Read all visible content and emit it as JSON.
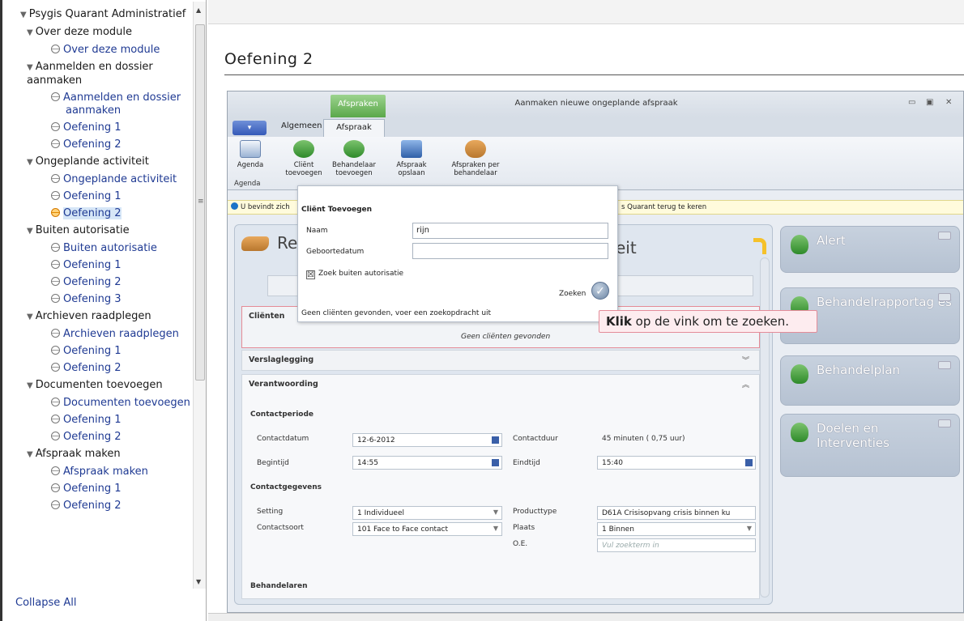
{
  "sidebar": {
    "items": [
      {
        "level": 0,
        "arrow": "▼",
        "label": "Psygis Quarant Administratief"
      },
      {
        "level": 1,
        "arrow": "▼",
        "label": "Over deze module"
      },
      {
        "level": 2,
        "label": "Over deze module"
      },
      {
        "level": 1,
        "arrow": "▼",
        "label": "Aanmelden en dossier aanmaken"
      },
      {
        "level": 2,
        "label": "Aanmelden en dossier aanmaken"
      },
      {
        "level": 2,
        "label": "Oefening 1"
      },
      {
        "level": 2,
        "label": "Oefening 2"
      },
      {
        "level": 1,
        "arrow": "▼",
        "label": "Ongeplande activiteit"
      },
      {
        "level": 2,
        "label": "Ongeplande activiteit"
      },
      {
        "level": 2,
        "label": "Oefening 1"
      },
      {
        "level": 2,
        "label": "Oefening 2",
        "active": true
      },
      {
        "level": 1,
        "arrow": "▼",
        "label": "Buiten autorisatie"
      },
      {
        "level": 2,
        "label": "Buiten autorisatie"
      },
      {
        "level": 2,
        "label": "Oefening 1"
      },
      {
        "level": 2,
        "label": "Oefening 2"
      },
      {
        "level": 2,
        "label": "Oefening 3"
      },
      {
        "level": 1,
        "arrow": "▼",
        "label": "Archieven raadplegen"
      },
      {
        "level": 2,
        "label": "Archieven raadplegen"
      },
      {
        "level": 2,
        "label": "Oefening 1"
      },
      {
        "level": 2,
        "label": "Oefening 2"
      },
      {
        "level": 1,
        "arrow": "▼",
        "label": "Documenten toevoegen"
      },
      {
        "level": 2,
        "label": "Documenten toevoegen"
      },
      {
        "level": 2,
        "label": "Oefening 1"
      },
      {
        "level": 2,
        "label": "Oefening 2"
      },
      {
        "level": 1,
        "arrow": "▼",
        "label": "Afspraak maken"
      },
      {
        "level": 2,
        "label": "Afspraak maken"
      },
      {
        "level": 2,
        "label": "Oefening 1"
      },
      {
        "level": 2,
        "label": "Oefening 2"
      }
    ],
    "collapse_label": "Collapse All"
  },
  "page": {
    "title": "Oefening 2"
  },
  "app": {
    "context_tab": "Afspraken",
    "window_title": "Aanmaken nieuwe ongeplande afspraak",
    "tabs": {
      "algemeen": "Algemeen",
      "afspraak": "Afspraak"
    },
    "ribbon": {
      "agenda": "Agenda",
      "client_l1": "Cliënt",
      "client_l2": "toevoegen",
      "behandelaar_l1": "Behandelaar",
      "behandelaar_l2": "toevoegen",
      "opslaan_l1": "Afspraak",
      "opslaan_l2": "opslaan",
      "perbeh_l1": "Afspraken per",
      "perbeh_l2": "behandelaar",
      "group_label": "Agenda"
    },
    "infobar": {
      "text": "U bevindt zich",
      "tail": "s Quarant terug te keren"
    },
    "panel": {
      "head_left": "Reg",
      "head_right": "eit"
    },
    "sections": {
      "clienten": "Cliënten",
      "geen_gevonden": "Geen cliënten gevonden",
      "verslaglegging": "Verslaglegging",
      "verantwoording": "Verantwoording",
      "contactperiode": "Contactperiode",
      "contactgegevens": "Contactgegevens",
      "behandelaren": "Behandelaren"
    },
    "form": {
      "contactdatum_label": "Contactdatum",
      "contactdatum": "12-6-2012",
      "contactduur_label": "Contactduur",
      "contactduur": "45 minuten ( 0,75 uur)",
      "begintijd_label": "Begintijd",
      "begintijd": "14:55",
      "eindtijd_label": "Eindtijd",
      "eindtijd": "15:40",
      "setting_label": "Setting",
      "setting": "1  Individueel",
      "producttype_label": "Producttype",
      "producttype": "D61A  Crisisopvang crisis binnen ku",
      "contactsoort_label": "Contactsoort",
      "contactsoort": "101  Face to Face contact",
      "plaats_label": "Plaats",
      "plaats": "1  Binnen",
      "oe_label": "O.E.",
      "oe_placeholder": "Vul zoekterm in"
    },
    "tiles": [
      "Alert",
      "Behandelrapportag es",
      "Behandelplan",
      "Doelen en Interventies"
    ]
  },
  "dialog": {
    "title": "Cliënt Toevoegen",
    "naam_label": "Naam",
    "naam_value": "rijn",
    "geboortedatum_label": "Geboortedatum",
    "geboortedatum_value": "",
    "checkbox_label": "Zoek buiten autorisatie",
    "checkbox_mark": "☒",
    "zoeken_label": "Zoeken",
    "message": "Geen cliënten gevonden, voer een zoekopdracht uit"
  },
  "tooltip": {
    "bold": "Klik",
    "text": " op de vink om te zoeken."
  },
  "colors": {
    "accent_green": "#5aa84a",
    "tooltip_border": "#e48c99",
    "link_blue": "#1f3a93"
  }
}
